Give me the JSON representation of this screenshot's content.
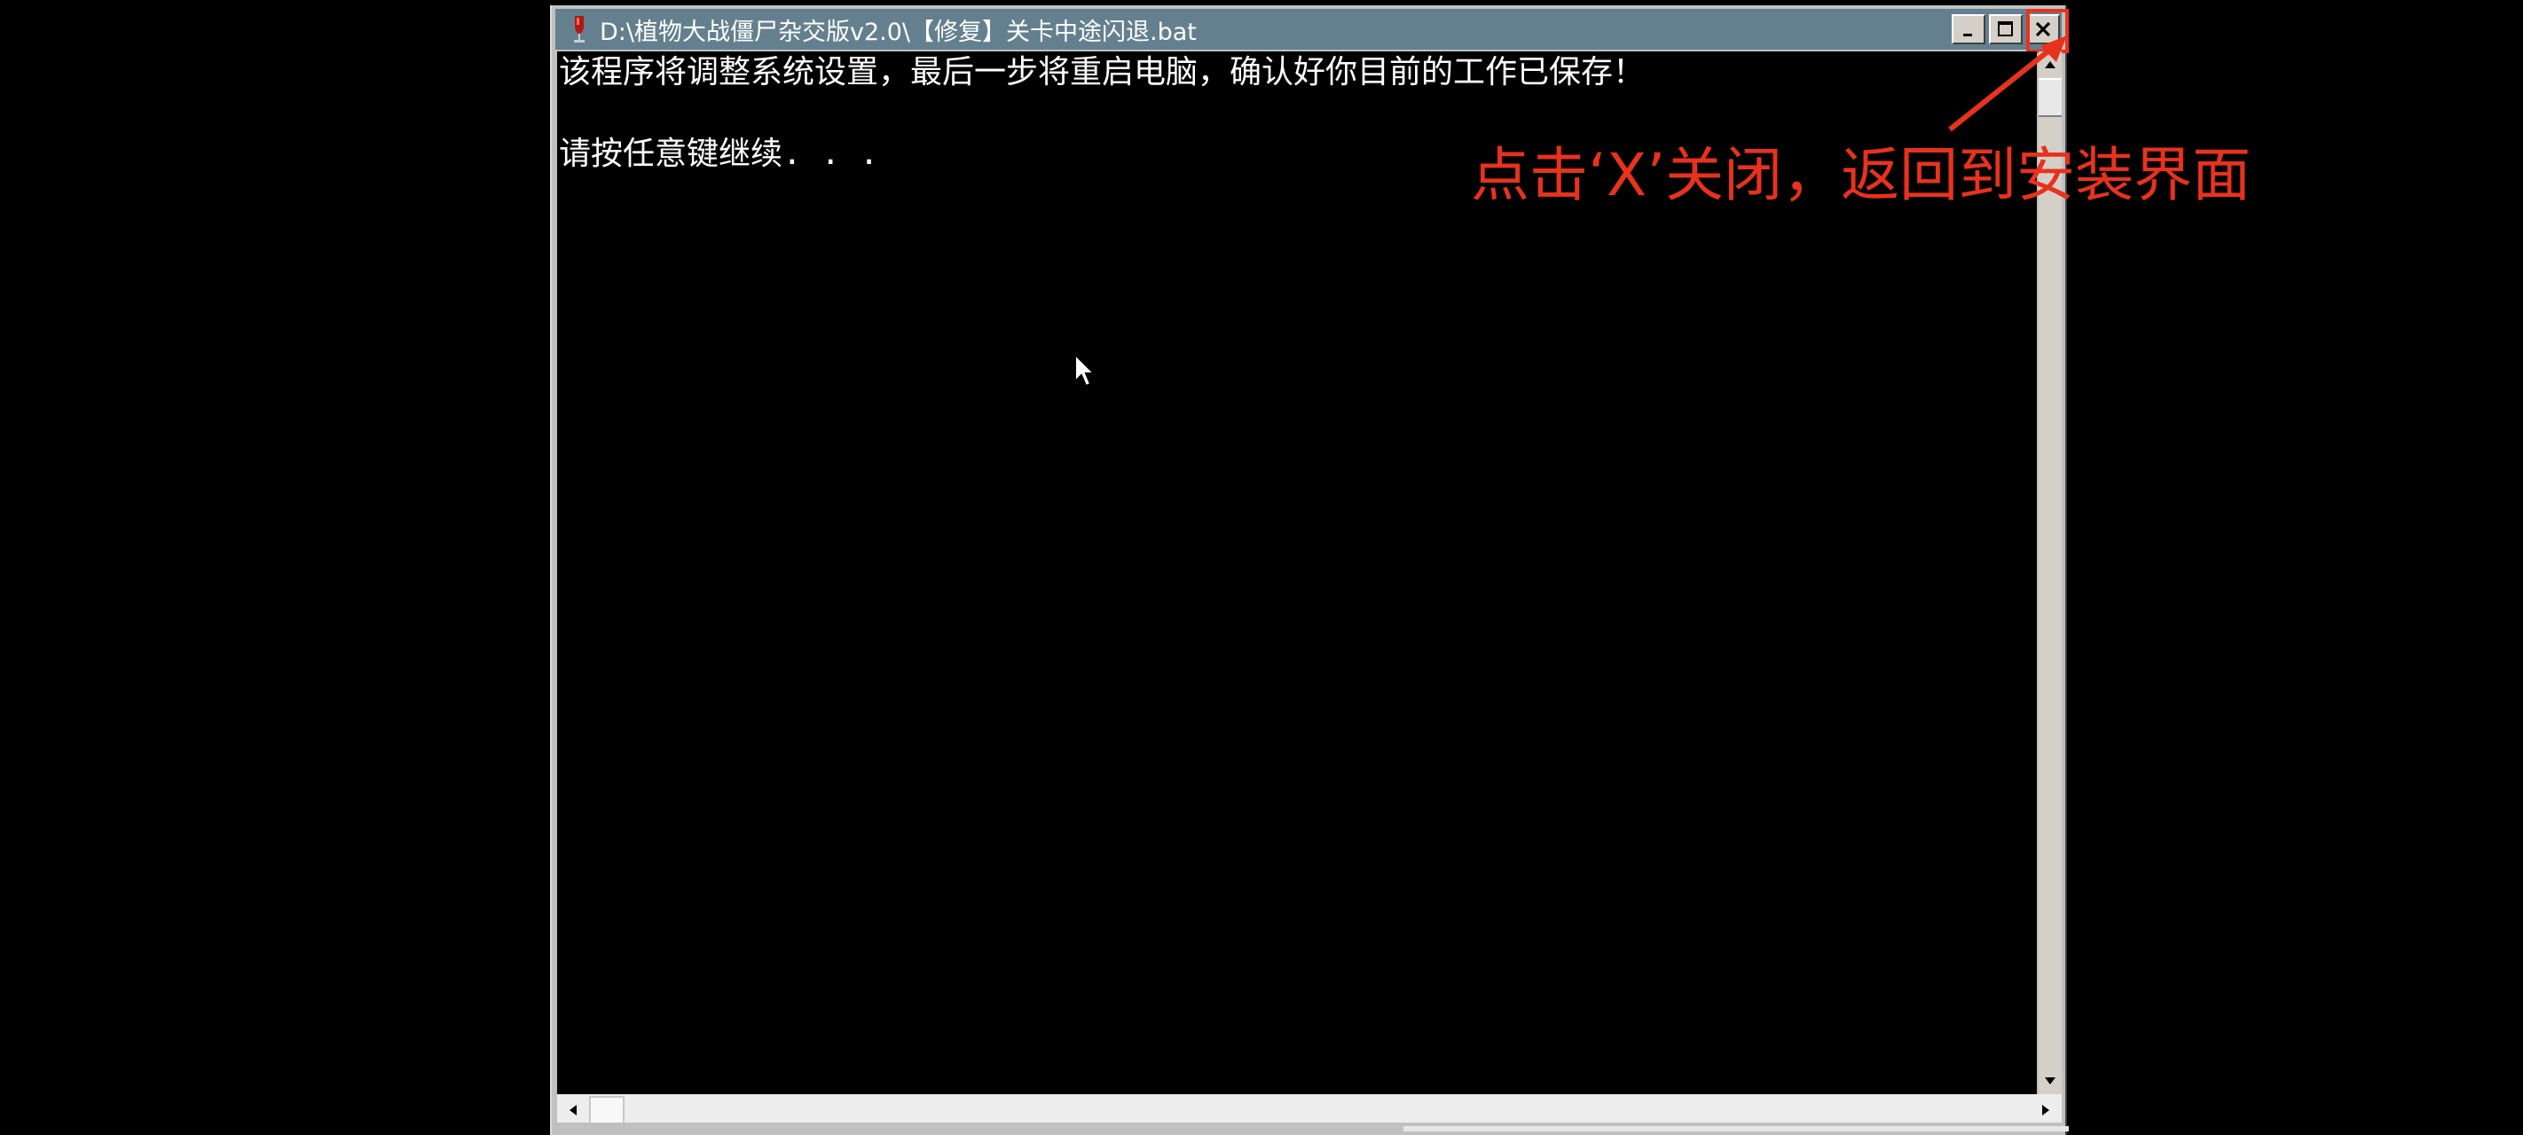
{
  "window": {
    "title": "D:\\植物大战僵尸杂交版v2.0\\【修复】关卡中途闪退.bat",
    "icon": "batch-file-icon",
    "buttons": {
      "minimize": "minimize-icon",
      "maximize": "maximize-icon",
      "close": "close-icon"
    }
  },
  "console": {
    "lines": [
      "该程序将调整系统设置，最后一步将重启电脑，确认好你目前的工作已保存！",
      "",
      "请按任意键继续. . ."
    ]
  },
  "annotation": {
    "text": "点击‘X’关闭，返回到安装界面",
    "color": "#e8321e"
  },
  "colors": {
    "title_bar": "#64808f",
    "console_bg": "#000000",
    "console_fg": "#ffffff",
    "annotation": "#e8321e"
  }
}
